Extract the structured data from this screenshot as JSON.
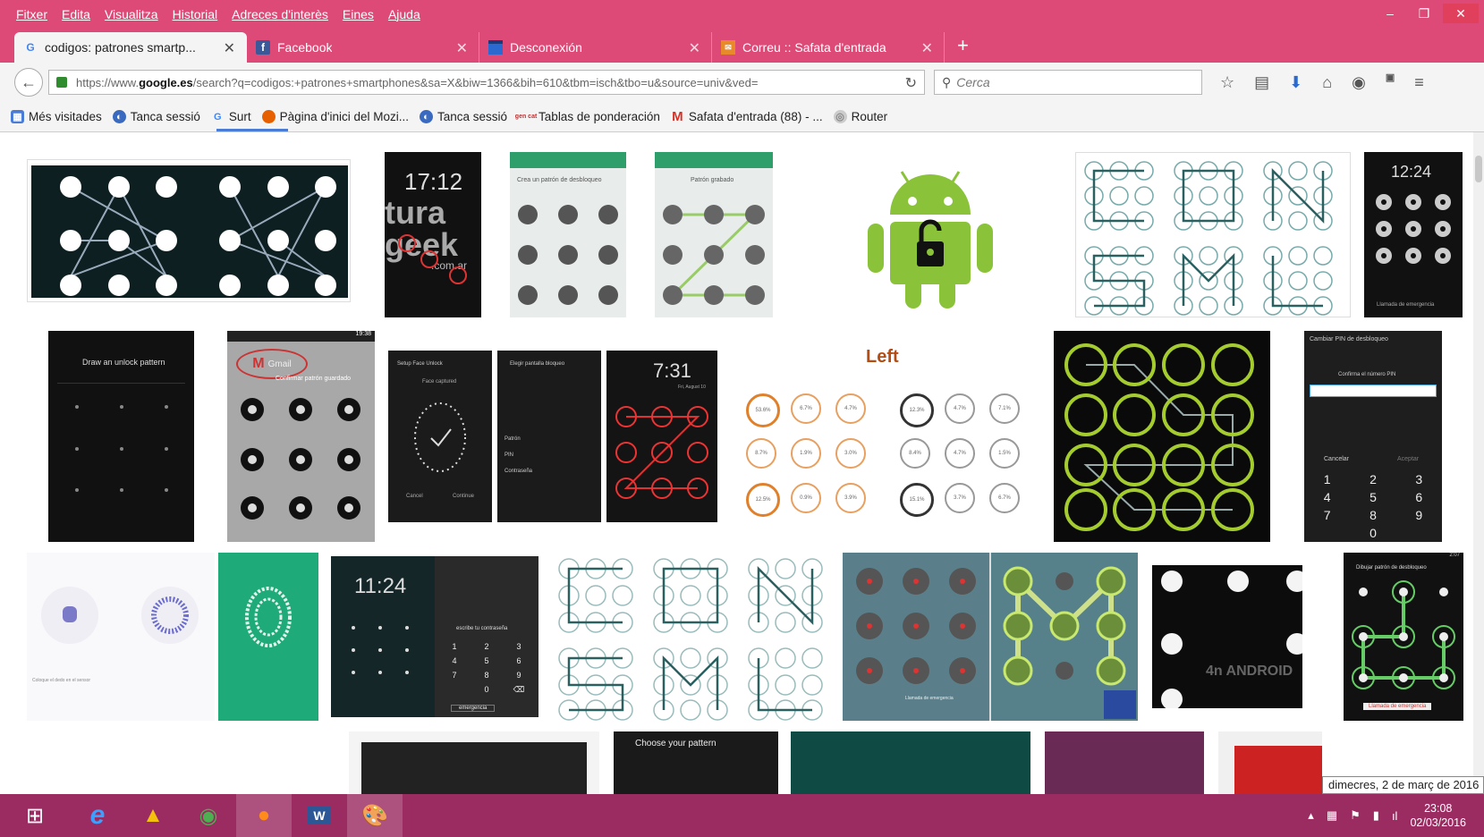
{
  "menubar": {
    "items": [
      "Fitxer",
      "Edita",
      "Visualitza",
      "Historial",
      "Adreces d'interès",
      "Eines",
      "Ajuda"
    ]
  },
  "tabs": [
    {
      "label": "codigos: patrones smartp...",
      "favicon": "google-g-icon",
      "active": true
    },
    {
      "label": "Facebook",
      "favicon": "facebook-icon",
      "active": false
    },
    {
      "label": "Desconexión",
      "favicon": "blue-page-icon",
      "active": false
    },
    {
      "label": "Correu :: Safata d'entrada",
      "favicon": "mail-icon",
      "active": false
    }
  ],
  "navbar": {
    "url_prefix": "https://www.",
    "url_domain": "google.es",
    "url_rest": "/search?q=codigos:+patrones+smartphones&sa=X&biw=1366&bih=610&tbm=isch&tbo=u&source=univ&ved=",
    "search_placeholder": "Cerca"
  },
  "bookmarks": [
    {
      "label": "Més visitades",
      "icon": "most-visited-icon"
    },
    {
      "label": "Tanca sessió",
      "icon": "blue-swirl-icon"
    },
    {
      "label": "Surt",
      "icon": "google-g-icon"
    },
    {
      "label": "Pàgina d'inici del Mozi...",
      "icon": "firefox-icon"
    },
    {
      "label": "Tanca sessió",
      "icon": "blue-swirl-icon"
    },
    {
      "label": "Tablas de ponderación",
      "icon": "gencat-icon",
      "icon_text": "gen cat"
    },
    {
      "label": "Safata d'entrada (88) - ...",
      "icon": "gmail-icon"
    },
    {
      "label": "Router",
      "icon": "globe-icon"
    }
  ],
  "thumbs": {
    "t2": {
      "time": "17:12",
      "brand1": "tura",
      "brand2": "geek",
      "brand3": ".com.ar"
    },
    "t3": {
      "title": "Crea un patrón de desbloqueo"
    },
    "t4": {
      "title": "Patrón grabado"
    },
    "t7": {
      "time": "12:24",
      "emergency": "Llamada de emergencia"
    },
    "t8": {
      "title": "Draw an unlock pattern"
    },
    "t9": {
      "title": "Gmail",
      "subtitle": "Confirmar patrón guardado",
      "status_time": "19:38"
    },
    "t10": {
      "title": "Setup Face Unlock",
      "subtitle": "Face captured",
      "cancel": "Cancel",
      "continue": "Continue"
    },
    "t11": {
      "title": "Elegir pantalla bloqueo",
      "items": [
        "Patrón",
        "PIN",
        "Contraseña"
      ]
    },
    "t12": {
      "time": "7:31",
      "date": "Fri, August 10"
    },
    "t13": {
      "title": "Left",
      "left_values": [
        "53.6%",
        "6.7%",
        "4.7%",
        "8.7%",
        "1.9%",
        "3.0%",
        "12.5%",
        "0.9%",
        "3.9%"
      ],
      "right_values": [
        "12.3%",
        "4.7%",
        "7.1%",
        "8.4%",
        "4.7%",
        "1.5%",
        "15.1%",
        "3.7%",
        "6.7%"
      ]
    },
    "t15": {
      "title": "Cambiar PIN de desbloqueo",
      "prompt": "Confirma el número PIN",
      "cancel": "Cancelar",
      "accept": "Aceptar",
      "keys": [
        "1",
        "2",
        "3",
        "4",
        "5",
        "6",
        "7",
        "8",
        "9",
        "0"
      ]
    },
    "t16": {
      "note": "Coloque el dedo en el sensor"
    },
    "t18": {
      "time": "11:24",
      "label": "escribe tu contraseña",
      "keys": [
        "1",
        "2",
        "3",
        "4",
        "5",
        "6",
        "7",
        "8",
        "9",
        "0"
      ],
      "emergency": "emergencia"
    },
    "t20": {
      "call": "Llamada de emergencia"
    },
    "t21": {
      "brand": "4n ANDROID"
    },
    "t22": {
      "title": "Dibujar patrón de desbloqueo",
      "emergency": "Llamada de emergencia",
      "status_time": "2:07"
    },
    "r4a": {
      "title": "Choose your pattern"
    }
  },
  "tooltip": "dimecres, 2 de març de 2016",
  "taskbar": {
    "time": "23:08",
    "date": "02/03/2016"
  },
  "colors": {
    "chrome": "#de4a78",
    "taskbar": "#9b2c62",
    "android_green": "#8ac23a",
    "accent_blue": "#4a7cd6"
  }
}
